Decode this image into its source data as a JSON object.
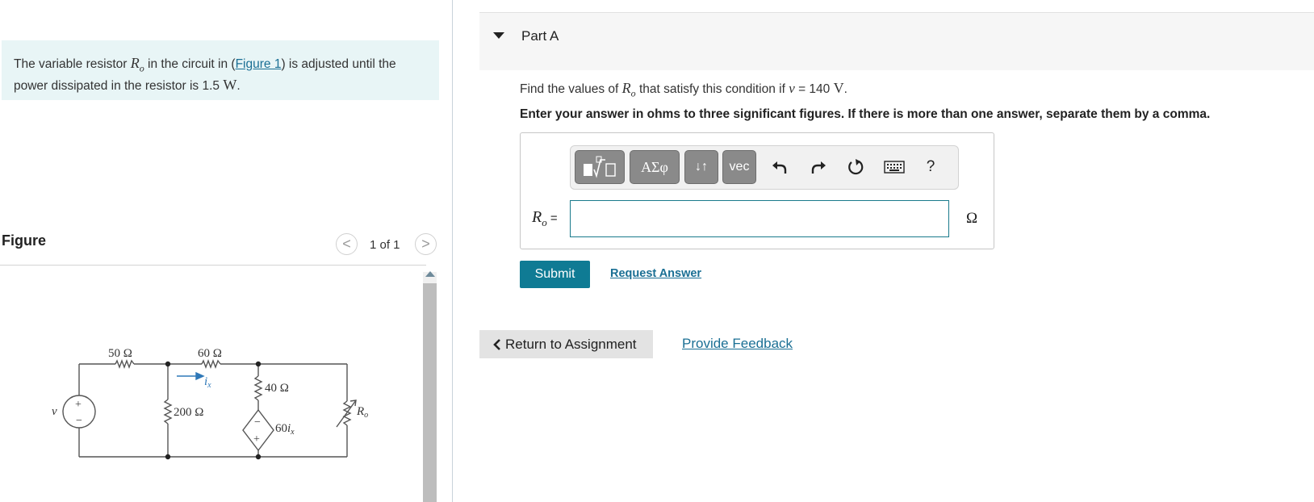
{
  "problem": {
    "text_before": "The variable resistor ",
    "var_symbol": "R",
    "var_sub": "o",
    "text_mid": " in the circuit in (",
    "figure_link": "Figure 1",
    "text_after_link": ") is adjusted until the power dissipated in the resistor is 1.5 ",
    "unit": "W",
    "period": "."
  },
  "figure": {
    "heading": "Figure",
    "pager": "1 of 1",
    "prev_glyph": "<",
    "next_glyph": ">",
    "labels": {
      "r1": "50 Ω",
      "r2": "60 Ω",
      "r3": "40 Ω",
      "r4": "200 Ω",
      "source": "v",
      "plus": "+",
      "minus": "−",
      "current": "i",
      "current_sub": "x",
      "dep_source": "60",
      "dep_source_var": "i",
      "dep_source_sub": "x",
      "ro_symbol": "R",
      "ro_sub": "o"
    }
  },
  "part": {
    "title": "Part A",
    "question_before": "Find the values of ",
    "q_symbol": "R",
    "q_sub": "o",
    "question_mid": " that satisfy this condition if ",
    "q_var": "v",
    "question_value": " = 140 ",
    "q_unit": "V",
    "q_period": ".",
    "instruction": "Enter your answer in ohms to three significant figures. If there is more than one answer, separate them by a comma.",
    "toolbar": {
      "templates_icon": "templates-icon",
      "greek_label": "ΑΣφ",
      "arrows_label": "↓↑",
      "vec_label": "vec",
      "undo_icon": "undo-icon",
      "redo_icon": "redo-icon",
      "reset_icon": "reset-icon",
      "keyboard_icon": "keyboard-icon",
      "help_label": "?"
    },
    "answer_label_symbol": "R",
    "answer_label_sub": "o",
    "answer_label_eq": " =",
    "answer_value": "",
    "answer_unit": "Ω",
    "submit_label": "Submit",
    "request_answer_label": "Request Answer"
  },
  "footer": {
    "return_label": "Return to Assignment",
    "feedback_label": "Provide Feedback"
  },
  "colors": {
    "accent": "#0f7b94",
    "link": "#1a6f94",
    "problem_bg": "#e8f5f6",
    "current_arrow": "#2e78b8"
  }
}
